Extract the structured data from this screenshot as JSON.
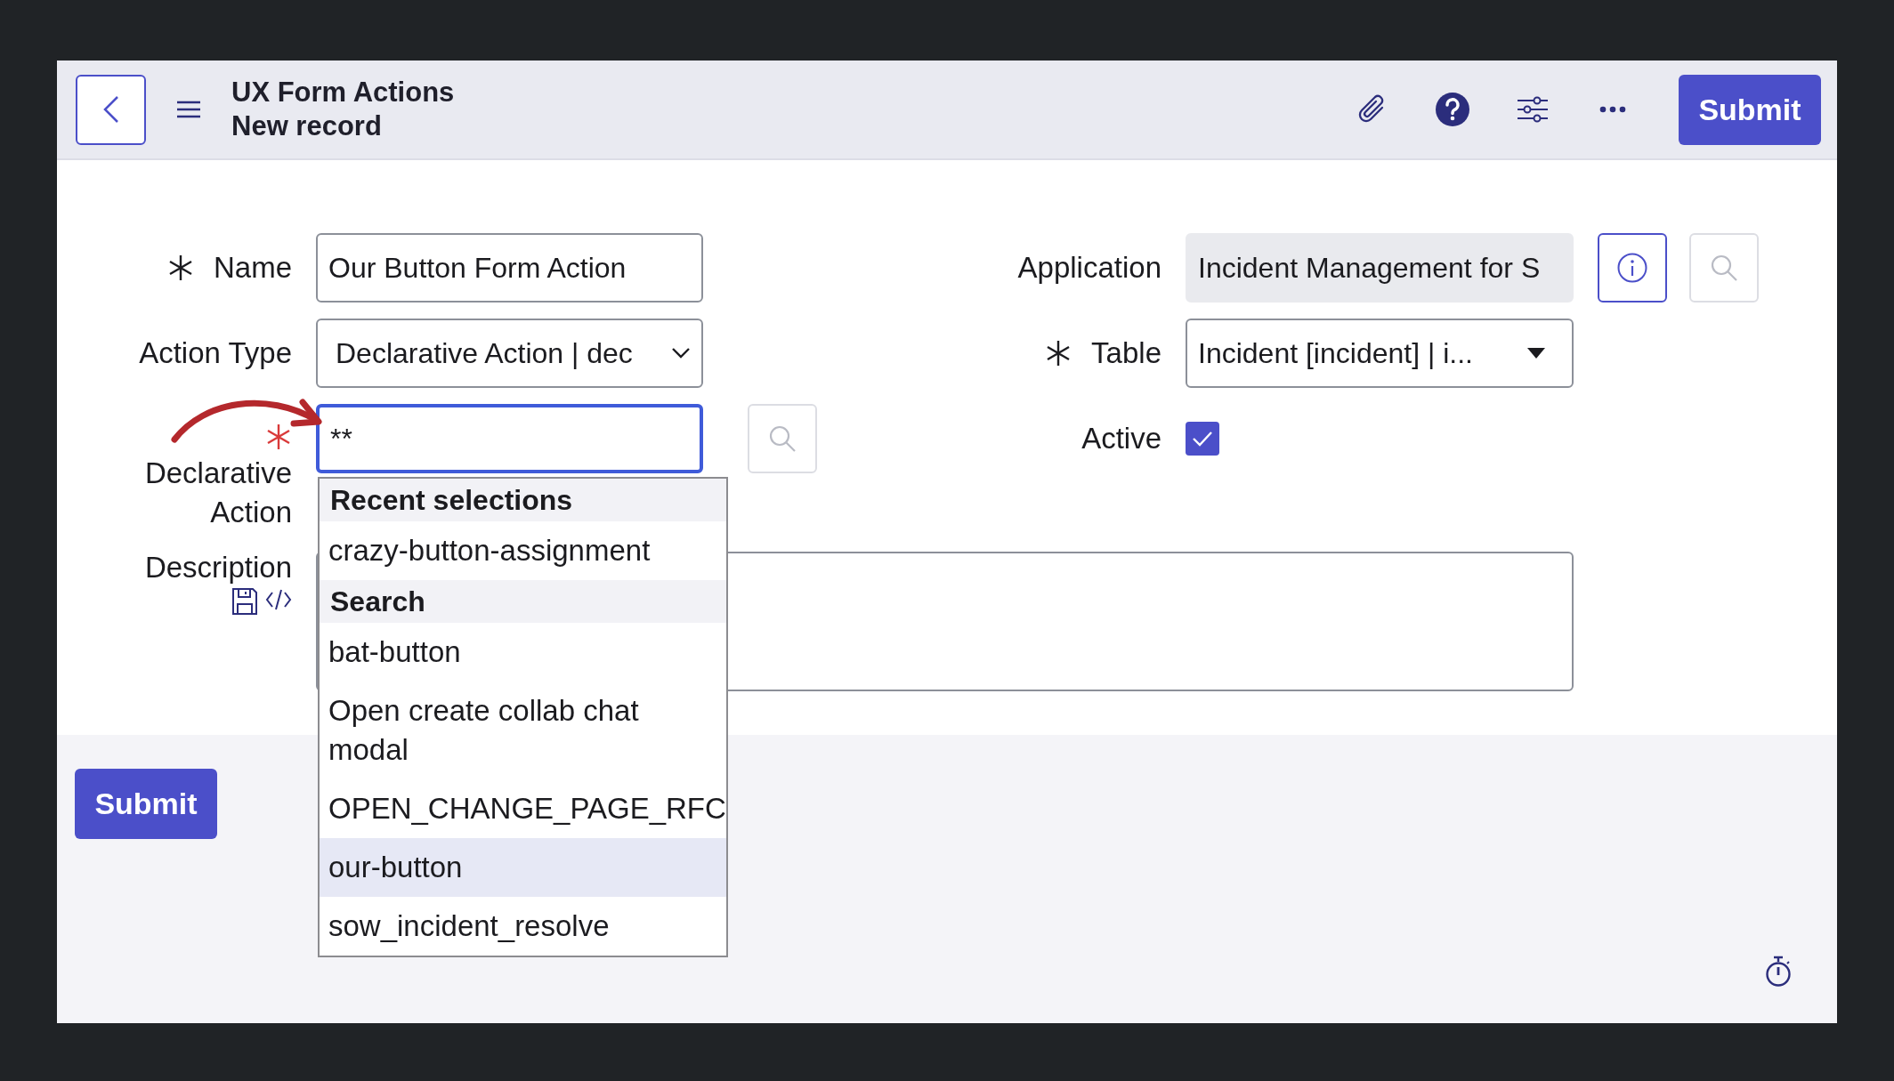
{
  "header": {
    "title": "UX Form Actions",
    "subtitle": "New record",
    "submit": "Submit"
  },
  "form": {
    "name": {
      "label": "Name",
      "required": true,
      "satisfied": true,
      "value": "Our Button Form Action"
    },
    "action_type": {
      "label": "Action Type",
      "value": "Declarative Action | dec"
    },
    "declarative_action": {
      "label": "Declarative Action",
      "required": true,
      "satisfied": false,
      "focused": true,
      "value": "**"
    },
    "description": {
      "label": "Description"
    },
    "application": {
      "label": "Application",
      "readonly": true,
      "value": "Incident Management for S"
    },
    "table": {
      "label": "Table",
      "required": true,
      "satisfied": true,
      "value": "Incident [incident] | i..."
    },
    "active": {
      "label": "Active",
      "checked": true
    }
  },
  "dropdown": {
    "sections": [
      {
        "title": "Recent selections",
        "items": [
          {
            "label": "crazy-button-assignment",
            "highlighted": false
          }
        ]
      },
      {
        "title": "Search",
        "items": [
          {
            "label": "bat-button",
            "highlighted": false
          },
          {
            "label": "Open create collab chat modal",
            "highlighted": false
          },
          {
            "label": "OPEN_CHANGE_PAGE_RFC",
            "highlighted": false
          },
          {
            "label": "our-button",
            "highlighted": true
          },
          {
            "label": "sow_incident_resolve",
            "highlighted": false
          }
        ]
      }
    ]
  },
  "footer": {
    "submit": "Submit"
  }
}
